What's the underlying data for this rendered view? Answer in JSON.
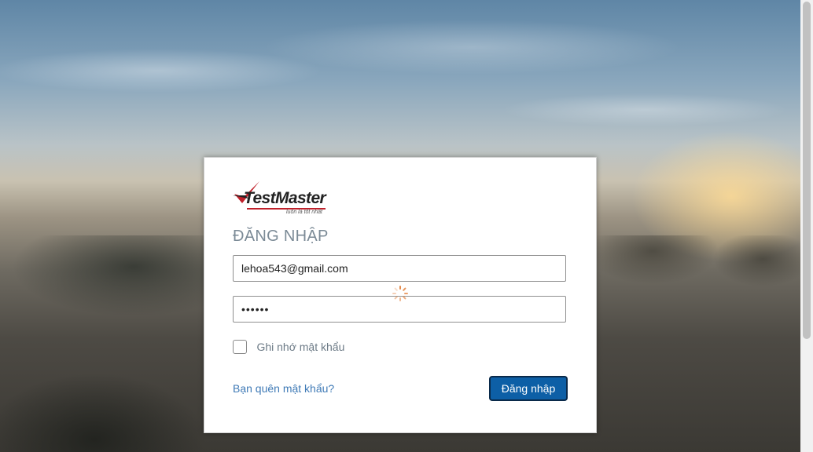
{
  "brand": {
    "name": "TestMaster",
    "slogan": "luôn là tốt nhất",
    "accent_color": "#c0202a"
  },
  "login": {
    "title": "ĐĂNG NHẬP",
    "email_value": "lehoa543@gmail.com",
    "password_value": "••••••",
    "remember_label": "Ghi nhớ mật khẩu",
    "remember_checked": false,
    "forgot_link": "Bạn quên mật khẩu?",
    "submit_label": "Đăng nhập",
    "submit_color": "#0d5fa6"
  },
  "status": {
    "loading": true,
    "spinner_icon": "loading-spinner-icon"
  }
}
